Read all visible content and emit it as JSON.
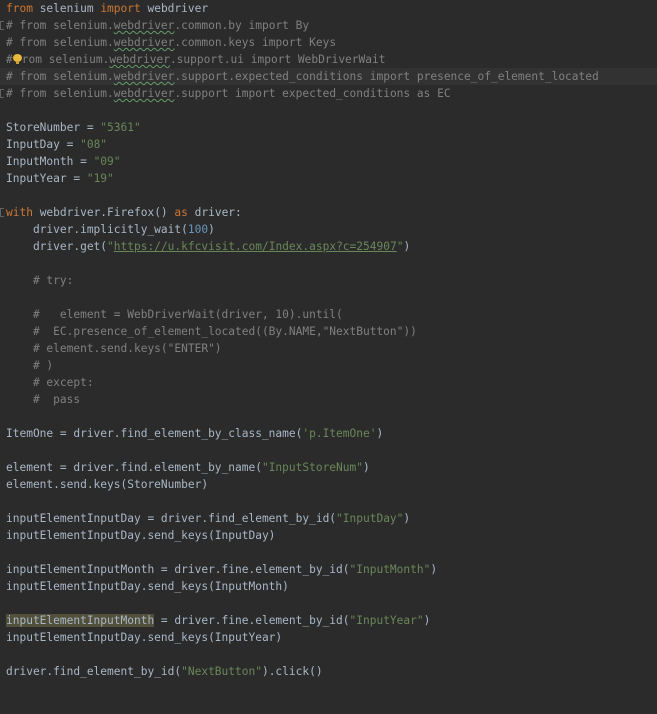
{
  "code": {
    "l01": {
      "from": "from",
      "mod": " selenium ",
      "imp": "import",
      "name": " webdriver"
    },
    "l02": {
      "a": "# from selenium.",
      "b": "webdriver",
      "c": ".common.by import By"
    },
    "l03": {
      "a": "# from selenium.",
      "b": "webdriver",
      "c": ".common.keys import Keys"
    },
    "l04": {
      "a": "#",
      "a2": "rom selenium.",
      "b": "webdriver",
      "c": ".support.ui import WebDriverWait"
    },
    "l05": {
      "a": "# from selenium.",
      "b": "webdriver",
      "c": ".support.expected_conditions import presence_of_element_located"
    },
    "l06": {
      "a": "# from selenium.",
      "b": "webdriver",
      "c": ".support import expected_conditions as EC"
    },
    "l08": {
      "a": "StoreNumber = ",
      "s": "\"5361\""
    },
    "l09": {
      "a": "InputDay = ",
      "s": "\"08\""
    },
    "l10": {
      "a": "InputMonth = ",
      "s": "\"09\""
    },
    "l11": {
      "a": "InputYear = ",
      "s": "\"19\""
    },
    "l13": {
      "with": "with",
      "a": " webdriver.Firefox() ",
      "as": "as",
      "b": " driver:"
    },
    "l14": {
      "a": "    driver.implicitly_wait(",
      "n": "100",
      "b": ")"
    },
    "l15": {
      "a": "    driver.get(",
      "q1": "\"",
      "url": "https://u.kfcvisit.com/Index.aspx?c=254907",
      "q2": "\"",
      "b": ")"
    },
    "l17": "    # try:",
    "l19": "    #   element = WebDriverWait(driver, 10).until(",
    "l20": "    #  EC.presence_of_element_located((By.NAME,\"NextButton\"))",
    "l21": "    # element.send.keys(\"ENTER\")",
    "l22": "    # )",
    "l23": "    # except:",
    "l24": "    #  pass",
    "l26": {
      "a": "ItemOne = driver.find_element_by_class_name(",
      "s": "'p.ItemOne'",
      "b": ")"
    },
    "l28": {
      "a": "element = driver.find.element_by_name(",
      "s": "\"InputStoreNum\"",
      "b": ")"
    },
    "l29": "element.send.keys(StoreNumber)",
    "l31": {
      "a": "inputElementInputDay = driver.find_element_by_id(",
      "s": "\"InputDay\"",
      "b": ")"
    },
    "l32": "inputElementInputDay.send_keys(InputDay)",
    "l34": {
      "a": "inputElementInputMonth = driver.fine.element_by_id(",
      "s": "\"InputMonth\"",
      "b": ")"
    },
    "l35": "inputElementInputDay.send_keys(InputMonth)",
    "l37": {
      "hl": "inputElementInputMonth",
      "a": " = driver.fine.element_by_id(",
      "s": "\"InputYear\"",
      "b": ")"
    },
    "l38": "inputElementInputDay.send_keys(InputYear)",
    "l40": {
      "a": "driver.find_element_by_id(",
      "s": "\"NextButton\"",
      "b": ").click()"
    }
  },
  "icons": {
    "intention": "lightbulb-icon",
    "fold": "fold-marker-icon"
  },
  "colors": {
    "background": "#2b2b2b",
    "text": "#a9b7c6",
    "keyword": "#cc7832",
    "string": "#6a8759",
    "number": "#6897bb",
    "comment": "#808080",
    "highlight": "#52503a"
  }
}
